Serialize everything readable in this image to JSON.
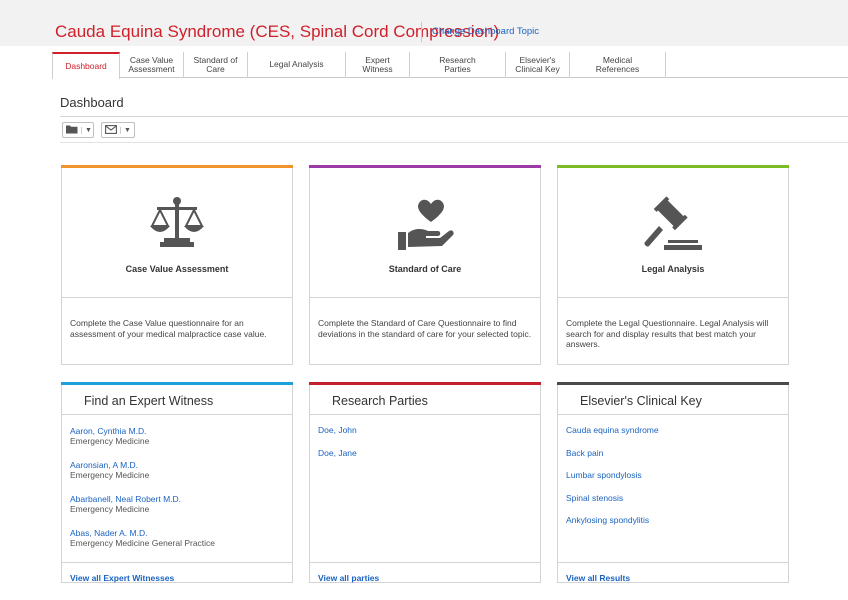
{
  "header": {
    "title": "Cauda Equina Syndrome (CES, Spinal Cord Compression)",
    "change_topic": "Change Dashboard Topic"
  },
  "tabs": [
    {
      "label": "Dashboard",
      "active": true
    },
    {
      "label": "Case Value\nAssessment"
    },
    {
      "label": "Standard of\nCare"
    },
    {
      "label": "Legal Analysis"
    },
    {
      "label": "Expert\nWitness"
    },
    {
      "label": "Research\nParties"
    },
    {
      "label": "Elsevier's\nClinical Key"
    },
    {
      "label": "Medical\nReferences"
    }
  ],
  "page": {
    "heading": "Dashboard",
    "toolbar": [
      {
        "icon": "folder-icon"
      },
      {
        "icon": "mail-icon"
      }
    ]
  },
  "feature_cards": [
    {
      "title": "Case Value Assessment",
      "icon": "scales-icon",
      "accent": "#f0932b",
      "description": "Complete the Case Value questionnaire for an assessment of your medical malpractice case value."
    },
    {
      "title": "Standard of Care",
      "icon": "heart-hand-icon",
      "accent": "#9b3ba5",
      "description": "Complete the Standard of Care Questionnaire to find deviations in the standard of care for your selected topic."
    },
    {
      "title": "Legal Analysis",
      "icon": "gavel-icon",
      "accent": "#7cbc24",
      "description": "Complete the Legal Questionnaire. Legal Analysis will search for and display results that best match your answers."
    }
  ],
  "expert_witness": {
    "title": "Find an Expert Witness",
    "accent": "#1ea0d8",
    "experts": [
      {
        "name": "Aaron, Cynthia M.D.",
        "specialty": "Emergency Medicine"
      },
      {
        "name": "Aaronsian, A M.D.",
        "specialty": "Emergency Medicine"
      },
      {
        "name": "Abarbanell, Neal Robert M.D.",
        "specialty": "Emergency Medicine"
      },
      {
        "name": "Abas, Nader A. M.D.",
        "specialty": "Emergency Medicine General Practice"
      }
    ],
    "footer_link": "View all Expert Witnesses"
  },
  "research_parties": {
    "title": "Research Parties",
    "accent": "#c0212d",
    "parties": [
      "Doe, John",
      "Doe, Jane"
    ],
    "footer_link": "View all parties"
  },
  "clinical_key": {
    "title": "Elsevier's Clinical Key",
    "accent": "#4a4a4a",
    "results": [
      "Cauda equina syndrome",
      "Back pain",
      "Lumbar spondylosis",
      "Spinal stenosis",
      "Ankylosing spondylitis"
    ],
    "footer_link": "View all Results"
  }
}
